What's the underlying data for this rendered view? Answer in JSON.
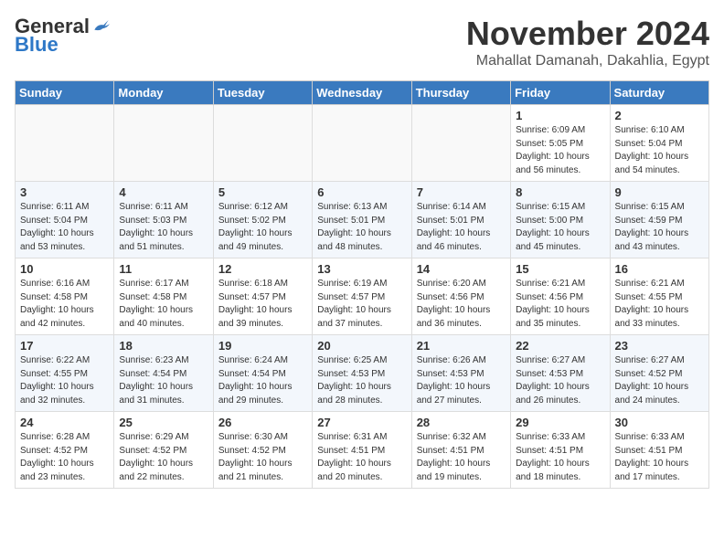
{
  "logo": {
    "general": "General",
    "blue": "Blue"
  },
  "title": "November 2024",
  "subtitle": "Mahallat Damanah, Dakahlia, Egypt",
  "days_of_week": [
    "Sunday",
    "Monday",
    "Tuesday",
    "Wednesday",
    "Thursday",
    "Friday",
    "Saturday"
  ],
  "weeks": [
    [
      {
        "day": "",
        "info": ""
      },
      {
        "day": "",
        "info": ""
      },
      {
        "day": "",
        "info": ""
      },
      {
        "day": "",
        "info": ""
      },
      {
        "day": "",
        "info": ""
      },
      {
        "day": "1",
        "info": "Sunrise: 6:09 AM\nSunset: 5:05 PM\nDaylight: 10 hours and 56 minutes."
      },
      {
        "day": "2",
        "info": "Sunrise: 6:10 AM\nSunset: 5:04 PM\nDaylight: 10 hours and 54 minutes."
      }
    ],
    [
      {
        "day": "3",
        "info": "Sunrise: 6:11 AM\nSunset: 5:04 PM\nDaylight: 10 hours and 53 minutes."
      },
      {
        "day": "4",
        "info": "Sunrise: 6:11 AM\nSunset: 5:03 PM\nDaylight: 10 hours and 51 minutes."
      },
      {
        "day": "5",
        "info": "Sunrise: 6:12 AM\nSunset: 5:02 PM\nDaylight: 10 hours and 49 minutes."
      },
      {
        "day": "6",
        "info": "Sunrise: 6:13 AM\nSunset: 5:01 PM\nDaylight: 10 hours and 48 minutes."
      },
      {
        "day": "7",
        "info": "Sunrise: 6:14 AM\nSunset: 5:01 PM\nDaylight: 10 hours and 46 minutes."
      },
      {
        "day": "8",
        "info": "Sunrise: 6:15 AM\nSunset: 5:00 PM\nDaylight: 10 hours and 45 minutes."
      },
      {
        "day": "9",
        "info": "Sunrise: 6:15 AM\nSunset: 4:59 PM\nDaylight: 10 hours and 43 minutes."
      }
    ],
    [
      {
        "day": "10",
        "info": "Sunrise: 6:16 AM\nSunset: 4:58 PM\nDaylight: 10 hours and 42 minutes."
      },
      {
        "day": "11",
        "info": "Sunrise: 6:17 AM\nSunset: 4:58 PM\nDaylight: 10 hours and 40 minutes."
      },
      {
        "day": "12",
        "info": "Sunrise: 6:18 AM\nSunset: 4:57 PM\nDaylight: 10 hours and 39 minutes."
      },
      {
        "day": "13",
        "info": "Sunrise: 6:19 AM\nSunset: 4:57 PM\nDaylight: 10 hours and 37 minutes."
      },
      {
        "day": "14",
        "info": "Sunrise: 6:20 AM\nSunset: 4:56 PM\nDaylight: 10 hours and 36 minutes."
      },
      {
        "day": "15",
        "info": "Sunrise: 6:21 AM\nSunset: 4:56 PM\nDaylight: 10 hours and 35 minutes."
      },
      {
        "day": "16",
        "info": "Sunrise: 6:21 AM\nSunset: 4:55 PM\nDaylight: 10 hours and 33 minutes."
      }
    ],
    [
      {
        "day": "17",
        "info": "Sunrise: 6:22 AM\nSunset: 4:55 PM\nDaylight: 10 hours and 32 minutes."
      },
      {
        "day": "18",
        "info": "Sunrise: 6:23 AM\nSunset: 4:54 PM\nDaylight: 10 hours and 31 minutes."
      },
      {
        "day": "19",
        "info": "Sunrise: 6:24 AM\nSunset: 4:54 PM\nDaylight: 10 hours and 29 minutes."
      },
      {
        "day": "20",
        "info": "Sunrise: 6:25 AM\nSunset: 4:53 PM\nDaylight: 10 hours and 28 minutes."
      },
      {
        "day": "21",
        "info": "Sunrise: 6:26 AM\nSunset: 4:53 PM\nDaylight: 10 hours and 27 minutes."
      },
      {
        "day": "22",
        "info": "Sunrise: 6:27 AM\nSunset: 4:53 PM\nDaylight: 10 hours and 26 minutes."
      },
      {
        "day": "23",
        "info": "Sunrise: 6:27 AM\nSunset: 4:52 PM\nDaylight: 10 hours and 24 minutes."
      }
    ],
    [
      {
        "day": "24",
        "info": "Sunrise: 6:28 AM\nSunset: 4:52 PM\nDaylight: 10 hours and 23 minutes."
      },
      {
        "day": "25",
        "info": "Sunrise: 6:29 AM\nSunset: 4:52 PM\nDaylight: 10 hours and 22 minutes."
      },
      {
        "day": "26",
        "info": "Sunrise: 6:30 AM\nSunset: 4:52 PM\nDaylight: 10 hours and 21 minutes."
      },
      {
        "day": "27",
        "info": "Sunrise: 6:31 AM\nSunset: 4:51 PM\nDaylight: 10 hours and 20 minutes."
      },
      {
        "day": "28",
        "info": "Sunrise: 6:32 AM\nSunset: 4:51 PM\nDaylight: 10 hours and 19 minutes."
      },
      {
        "day": "29",
        "info": "Sunrise: 6:33 AM\nSunset: 4:51 PM\nDaylight: 10 hours and 18 minutes."
      },
      {
        "day": "30",
        "info": "Sunrise: 6:33 AM\nSunset: 4:51 PM\nDaylight: 10 hours and 17 minutes."
      }
    ]
  ]
}
